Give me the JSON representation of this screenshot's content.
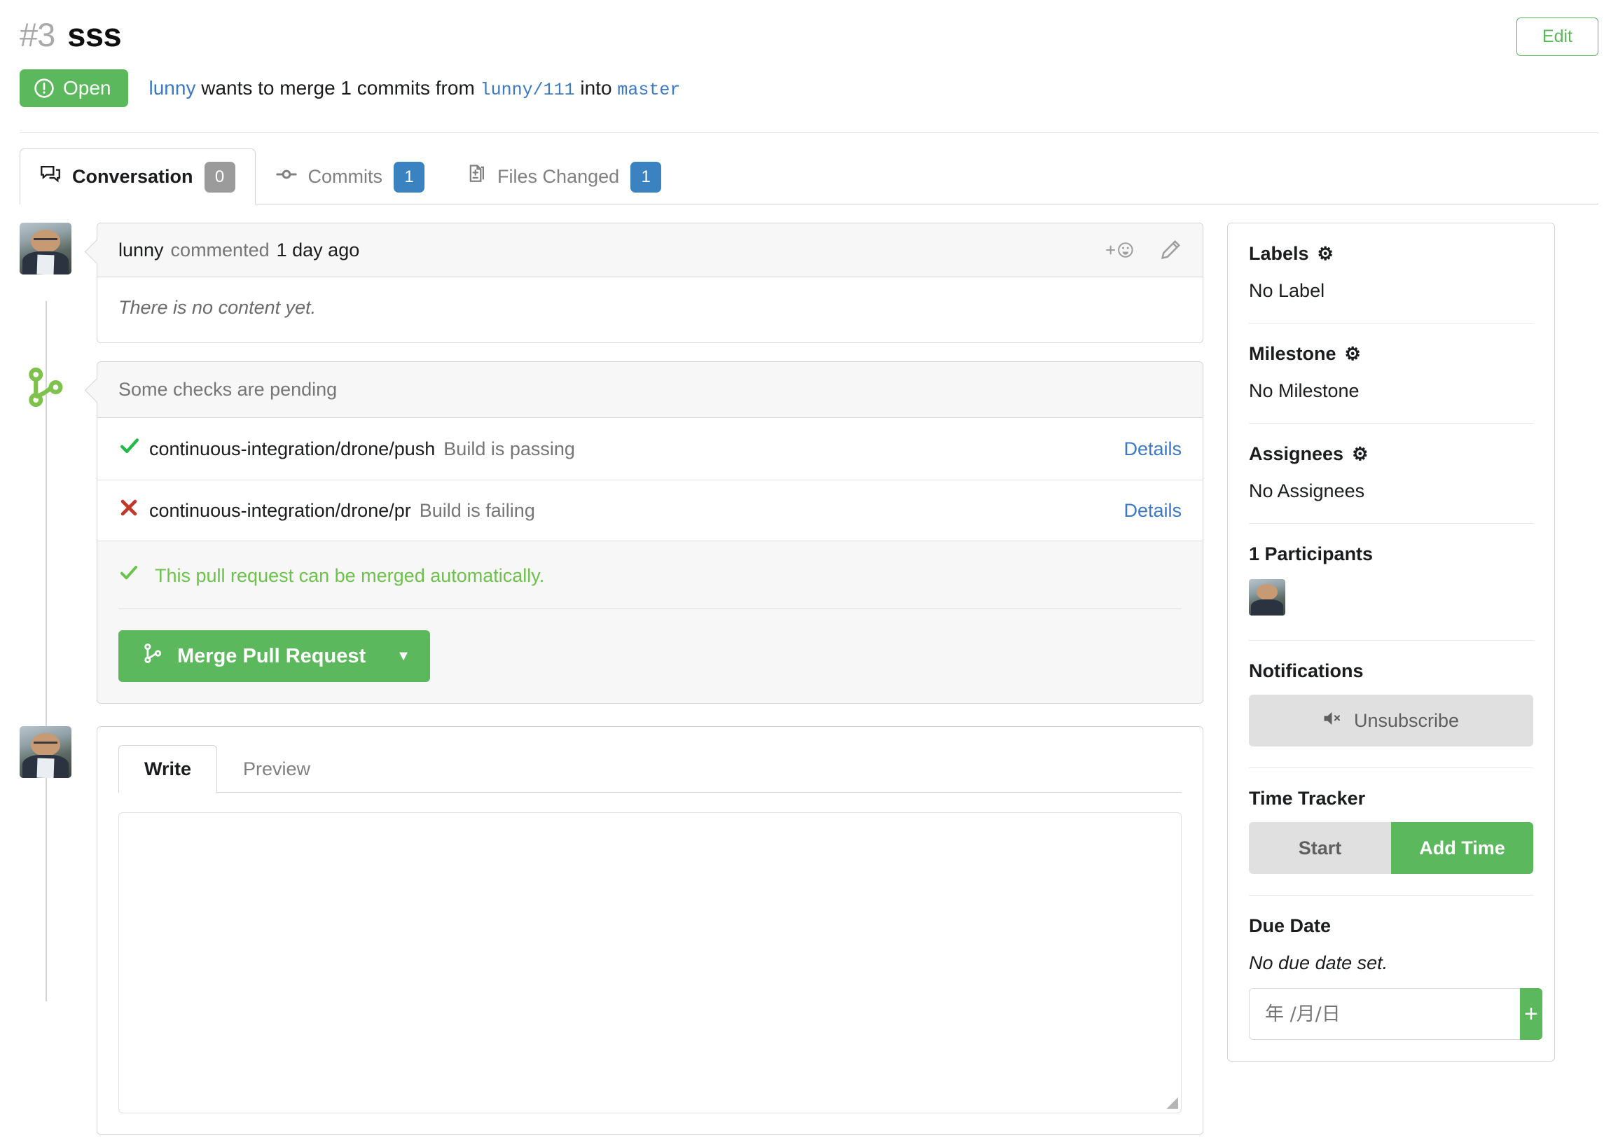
{
  "header": {
    "index": "#3",
    "title": "sss",
    "edit_label": "Edit",
    "status_badge": "Open",
    "status_color": "#5cb85c",
    "author": "lunny",
    "sub_mid": "wants to merge 1 commits from",
    "head_branch": "lunny/111",
    "sub_into": "into",
    "base_branch": "master"
  },
  "tabs": [
    {
      "label": "Conversation",
      "count": "0",
      "icon": "comment-discussion-icon",
      "active": true,
      "count_color": "grey"
    },
    {
      "label": "Commits",
      "count": "1",
      "icon": "git-commit-icon",
      "active": false,
      "count_color": "blue"
    },
    {
      "label": "Files Changed",
      "count": "1",
      "icon": "diff-file-icon",
      "active": false,
      "count_color": "blue"
    }
  ],
  "comment": {
    "author": "lunny",
    "action": "commented",
    "time": "1 day ago",
    "body": "There is no content yet.",
    "add_reaction_icon": "add-emoji-icon",
    "edit_icon": "pencil-icon"
  },
  "checks": {
    "headline": "Some checks are pending",
    "items": [
      {
        "state": "success",
        "context": "continuous-integration/drone/push",
        "description": "Build is passing",
        "details_label": "Details"
      },
      {
        "state": "failure",
        "context": "continuous-integration/drone/pr",
        "description": "Build is failing",
        "details_label": "Details"
      }
    ]
  },
  "merge": {
    "message": "This pull request can be merged automatically.",
    "button_label": "Merge Pull Request",
    "button_icon": "git-merge-icon",
    "dropdown_icon": "caret-down-icon"
  },
  "editor": {
    "tabs": [
      {
        "label": "Write",
        "active": true
      },
      {
        "label": "Preview",
        "active": false
      }
    ],
    "textarea_value": "",
    "textarea_placeholder": ""
  },
  "sidebar": {
    "labels": {
      "title": "Labels",
      "gear_icon": "gear-icon",
      "value": "No Label"
    },
    "milestone": {
      "title": "Milestone",
      "gear_icon": "gear-icon",
      "value": "No Milestone"
    },
    "assignees": {
      "title": "Assignees",
      "gear_icon": "gear-icon",
      "value": "No Assignees"
    },
    "participants": {
      "title": "1 Participants",
      "avatar_name": "lunny"
    },
    "notifications": {
      "title": "Notifications",
      "button_label": "Unsubscribe",
      "button_icon": "mute-icon"
    },
    "time_tracker": {
      "title": "Time Tracker",
      "start_label": "Start",
      "add_label": "Add Time"
    },
    "due_date": {
      "title": "Due Date",
      "empty_text": "No due date set.",
      "input_placeholder": "年 /月/日",
      "add_icon": "plus-icon"
    }
  }
}
